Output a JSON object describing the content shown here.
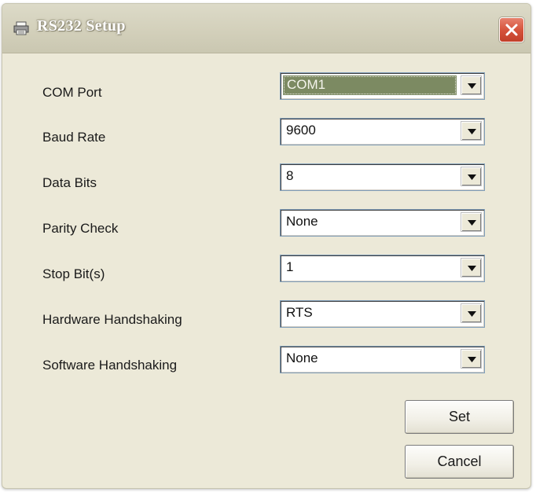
{
  "window": {
    "title": "RS232 Setup",
    "title_icon": "printer-icon",
    "close_icon": "close-icon"
  },
  "fields": [
    {
      "label": "COM Port",
      "value": "COM1",
      "selected": true
    },
    {
      "label": "Baud Rate",
      "value": "9600"
    },
    {
      "label": "Data Bits",
      "value": "8"
    },
    {
      "label": "Parity Check",
      "value": "None"
    },
    {
      "label": "Stop Bit(s)",
      "value": "1"
    },
    {
      "label": "Hardware Handshaking",
      "value": "RTS"
    },
    {
      "label": "Software Handshaking",
      "value": "None"
    }
  ],
  "buttons": {
    "set": "Set",
    "cancel": "Cancel"
  },
  "colors": {
    "dialog_bg": "#ece9d8",
    "close_red": "#d6543c",
    "selection_highlight": "#7c8a62",
    "field_border": "#7f9db9"
  }
}
